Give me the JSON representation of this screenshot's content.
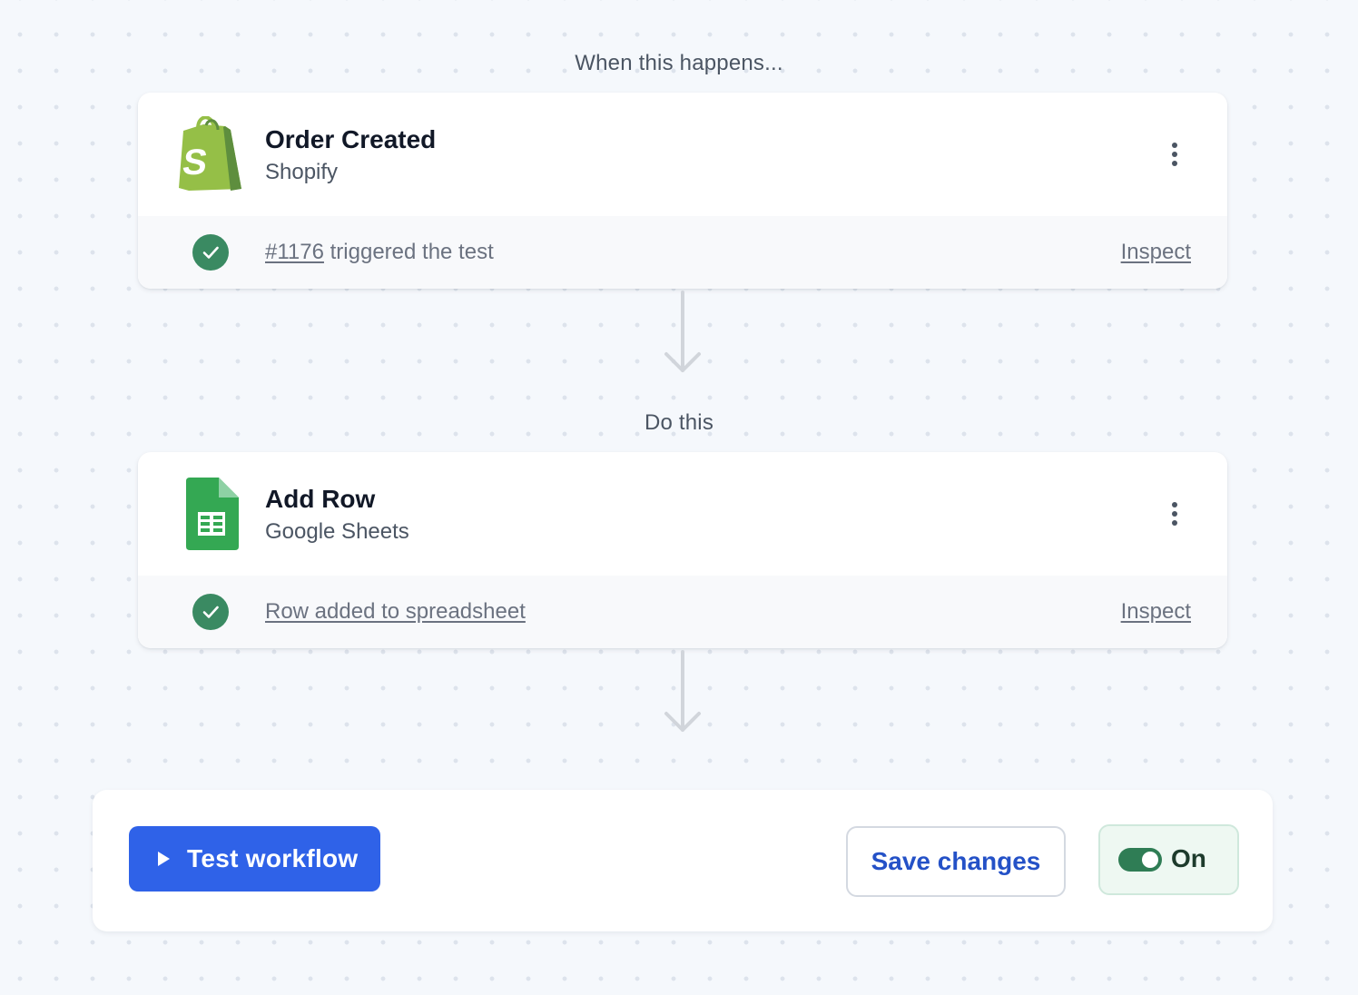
{
  "trigger_section": {
    "label": "When this happens...",
    "card": {
      "title": "Order Created",
      "app": "Shopify",
      "status_link": "#1176",
      "status_text": " triggered the test",
      "inspect_label": "Inspect"
    }
  },
  "action_section": {
    "label": "Do this",
    "card": {
      "title": "Add Row",
      "app": "Google Sheets",
      "status_link": "Row added to spreadsheet",
      "inspect_label": "Inspect"
    }
  },
  "footer": {
    "test_label": "Test workflow",
    "save_label": "Save changes",
    "toggle_label": "On",
    "toggle_on": true
  },
  "colors": {
    "primary": "#2f62e8",
    "success": "#3a8a62",
    "shopify_green": "#95bf47",
    "sheets_green": "#34a853"
  },
  "icons": {
    "trigger_app": "shopify-logo-icon",
    "action_app": "google-sheets-icon",
    "status": "check-circle-icon",
    "menu": "more-vertical-icon",
    "flow": "arrow-down-icon",
    "test": "play-icon"
  }
}
